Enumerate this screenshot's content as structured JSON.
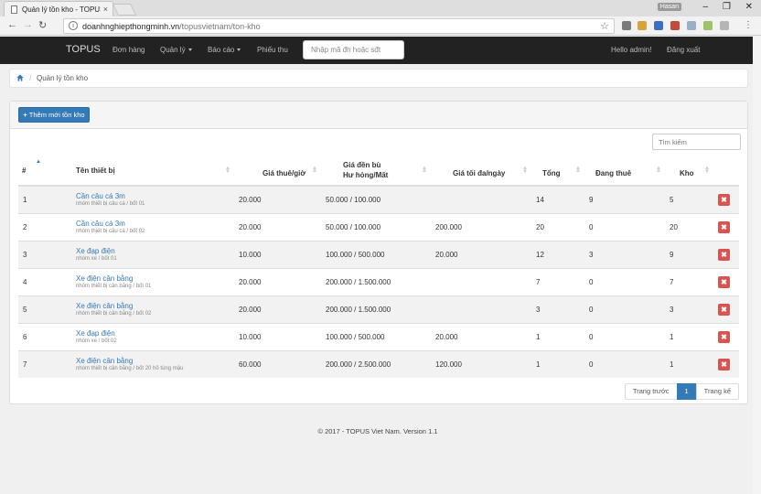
{
  "browser": {
    "tab_title": "Quản lý tồn kho - TOPUS",
    "tab_close": "×",
    "url_host": "doanhnghiepthongminh.vn",
    "url_path": "/topusvietnam/ton-kho",
    "user_chip": "Hasan",
    "info_symbol": "i",
    "star_symbol": "☆",
    "back_symbol": "←",
    "forward_symbol": "→",
    "reload_symbol": "↻",
    "menu_symbol": "⋮",
    "minimize_symbol": "–",
    "restore_symbol": "❐",
    "close_symbol": "✕"
  },
  "navbar": {
    "brand": "TOPUS",
    "items": [
      "Đơn hàng",
      "Quản lý",
      "Báo cáo",
      "Phiếu thu"
    ],
    "search_placeholder": "Nhập mã đh hoặc sđt",
    "greeting": "Hello admin!",
    "logout": "Đăng xuất"
  },
  "breadcrumb": {
    "separator": "/",
    "current": "Quản lý tồn kho"
  },
  "panel": {
    "add_icon": "+",
    "add_button": "Thêm mới tồn kho",
    "search_placeholder": "Tìm kiếm"
  },
  "table": {
    "headers": {
      "index": "#",
      "name": "Tên thiết bị",
      "rent": "Giá thuê/giờ",
      "comp_line1": "Giá đền bù",
      "comp_line2": "Hư hỏng/Mất",
      "maxday": "Giá tối đa/ngày",
      "total": "Tổng",
      "renting": "Đang thuê",
      "stock": "Kho"
    },
    "delete_symbol": "✖",
    "rows": [
      {
        "index": "1",
        "name": "Cần câu cá 3m",
        "sub": "nhóm thiết bị câu cá / bốt 01",
        "rent": "20.000",
        "comp": "50.000 / 100.000",
        "maxday": "",
        "total": "14",
        "renting": "9",
        "stock": "5"
      },
      {
        "index": "2",
        "name": "Cần câu cá 3m",
        "sub": "nhóm thiết bị câu cá / bốt 02",
        "rent": "20.000",
        "comp": "50.000 / 100.000",
        "maxday": "200.000",
        "total": "20",
        "renting": "0",
        "stock": "20"
      },
      {
        "index": "3",
        "name": "Xe đạp điện",
        "sub": "nhóm xe / bốt 01",
        "rent": "10.000",
        "comp": "100.000 / 500.000",
        "maxday": "20.000",
        "total": "12",
        "renting": "3",
        "stock": "9"
      },
      {
        "index": "4",
        "name": "Xe điện cân bằng",
        "sub": "nhóm thiết bị cân bằng / bốt 01",
        "rent": "20.000",
        "comp": "200.000 / 1.500.000",
        "maxday": "",
        "total": "7",
        "renting": "0",
        "stock": "7"
      },
      {
        "index": "5",
        "name": "Xe điện cân bằng",
        "sub": "nhóm thiết bị cân bằng / bốt 02",
        "rent": "20.000",
        "comp": "200.000 / 1.500.000",
        "maxday": "",
        "total": "3",
        "renting": "0",
        "stock": "3"
      },
      {
        "index": "6",
        "name": "Xe đạp điện",
        "sub": "nhóm xe / bốt 02",
        "rent": "10.000",
        "comp": "100.000 / 500.000",
        "maxday": "20.000",
        "total": "1",
        "renting": "0",
        "stock": "1"
      },
      {
        "index": "7",
        "name": "Xe điện cân bằng",
        "sub": "nhóm thiết bị cân bằng / bốt 20 hồ tùng mậu",
        "rent": "60.000",
        "comp": "200.000 / 2.500.000",
        "maxday": "120.000",
        "total": "1",
        "renting": "0",
        "stock": "1"
      }
    ]
  },
  "pagination": {
    "prev": "Trang trước",
    "current": "1",
    "next": "Trang kế"
  },
  "footer": "© 2017 - TOPUS Viet Nam. Version 1.1",
  "colors": {
    "primary": "#337ab7",
    "danger": "#d9534f",
    "navbar": "#222222"
  }
}
